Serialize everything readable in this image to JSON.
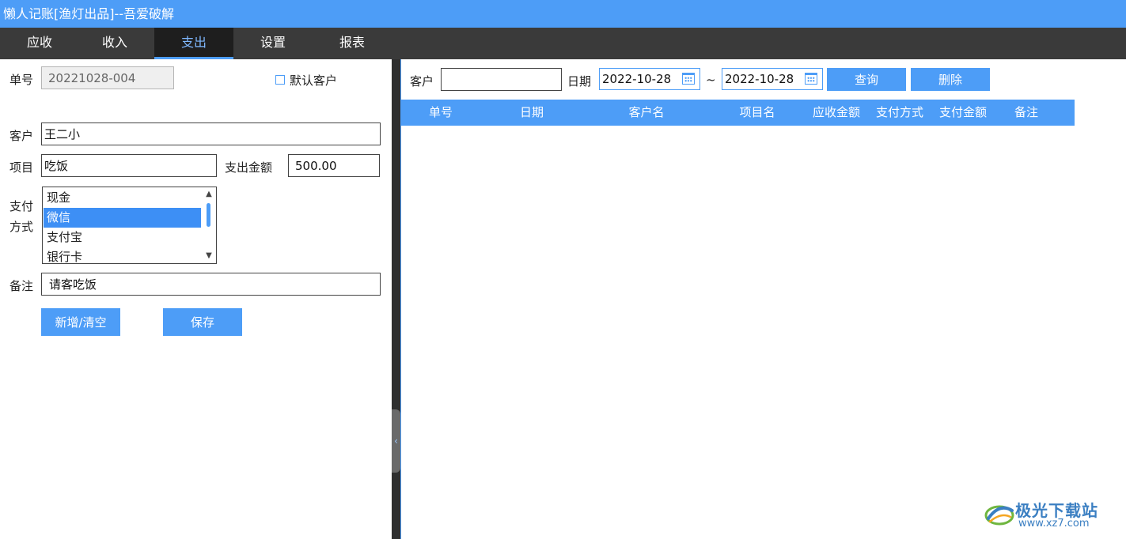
{
  "window": {
    "title": "懒人记账[渔灯出品]--吾爱破解"
  },
  "tabs": [
    {
      "label": "应收"
    },
    {
      "label": "收入"
    },
    {
      "label": "支出"
    },
    {
      "label": "设置"
    },
    {
      "label": "报表"
    }
  ],
  "active_tab": "支出",
  "form": {
    "order_no_label": "单号",
    "order_no_value": "20221028-004",
    "default_customer_label": "默认客户",
    "customer_label": "客户",
    "customer_value": "王二小",
    "item_label": "项目",
    "item_value": "吃饭",
    "amount_label": "支出金额",
    "amount_value": "500.00",
    "payment_label_1": "支付",
    "payment_label_2": "方式",
    "payment_options": [
      "现金",
      "微信",
      "支付宝",
      "银行卡"
    ],
    "payment_selected": "微信",
    "note_label": "备注",
    "note_value": "请客吃饭",
    "new_clear_button": "新增/清空",
    "save_button": "保存"
  },
  "query": {
    "customer_label": "客户",
    "customer_value": "",
    "date_label": "日期",
    "date_from": "2022-10-28",
    "date_sep": "~",
    "date_to": "2022-10-28",
    "search_button": "查询",
    "delete_button": "删除"
  },
  "table": {
    "columns": [
      "单号",
      "日期",
      "客户名",
      "项目名",
      "应收金额",
      "支付方式",
      "支付金额",
      "备注"
    ],
    "rows": []
  },
  "watermark": {
    "title": "极光下载站",
    "url": "www.xz7.com"
  },
  "colors": {
    "accent": "#4d9df7",
    "tabbar": "#3a3a3a",
    "selected": "#3d8ff5"
  }
}
